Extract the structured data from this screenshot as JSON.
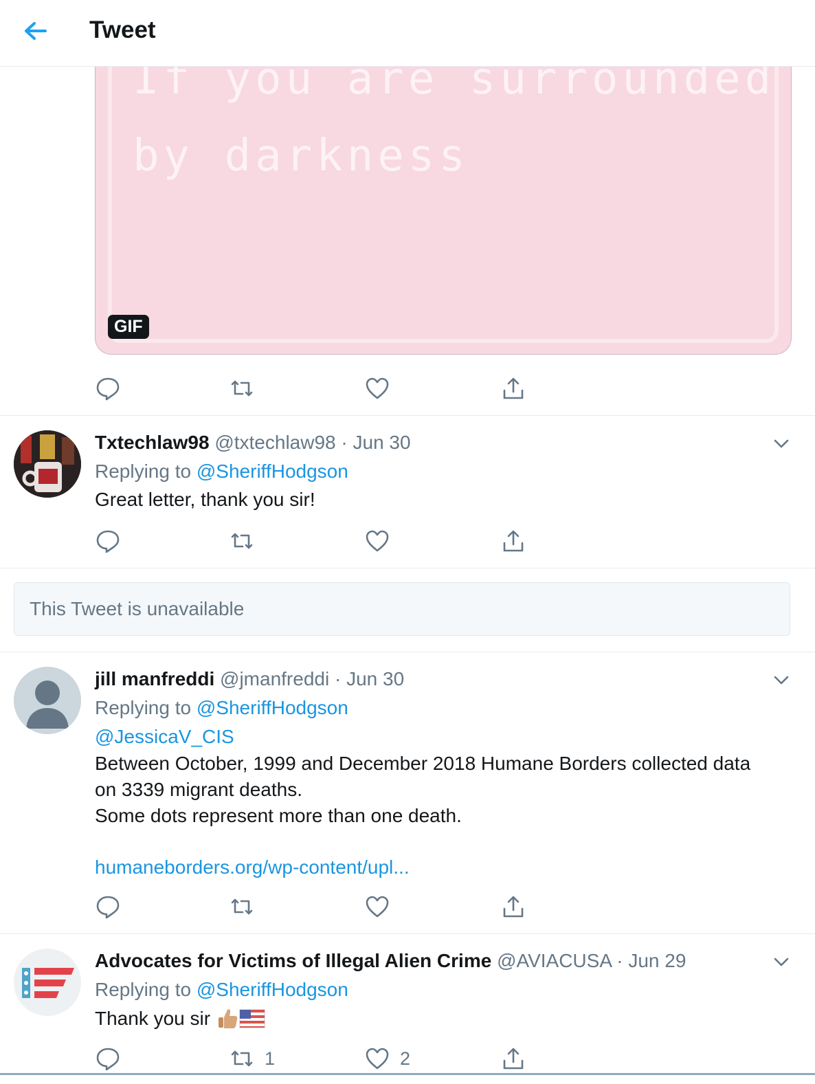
{
  "header": {
    "title": "Tweet"
  },
  "gif": {
    "line1": "If you are surrounded",
    "line2": "by darkness",
    "badge": "GIF"
  },
  "tweets": [
    {
      "name": "Txtechlaw98",
      "handle": "@txtechlaw98",
      "date": "Jun 30",
      "replying_prefix": "Replying to",
      "replying_to": "@SheriffHodgson",
      "text": "Great letter, thank you sir!"
    },
    {
      "name": "jill manfreddi",
      "handle": "@jmanfreddi",
      "date": "Jun 30",
      "replying_prefix": "Replying to",
      "replying_to": "@SheriffHodgson",
      "mention": "@JessicaV_CIS",
      "text_lines": [
        "Between October, 1999 and December 2018 Humane Borders collected data",
        "on 3339 migrant deaths.",
        "Some dots represent more than one death."
      ],
      "link": "humaneborders.org/wp-content/upl..."
    },
    {
      "name": "Advocates for Victims of Illegal Alien Crime",
      "handle": "@AVIACUSA",
      "date": "Jun 29",
      "replying_prefix": "Replying to",
      "replying_to": "@SheriffHodgson",
      "text": "Thank you sir",
      "retweet_count": "1",
      "like_count": "2"
    }
  ],
  "unavailable": {
    "text": "This Tweet is unavailable"
  },
  "date_separator": "·",
  "colors": {
    "accent": "#1b95e0",
    "secondary_text": "#657786",
    "gif_background": "#f8d8e1"
  },
  "icons": [
    "back-arrow-icon",
    "reply-icon",
    "retweet-icon",
    "like-icon",
    "share-icon",
    "chevron-down-icon",
    "thumbs-up-emoji-icon",
    "us-flag-emoji-icon"
  ]
}
